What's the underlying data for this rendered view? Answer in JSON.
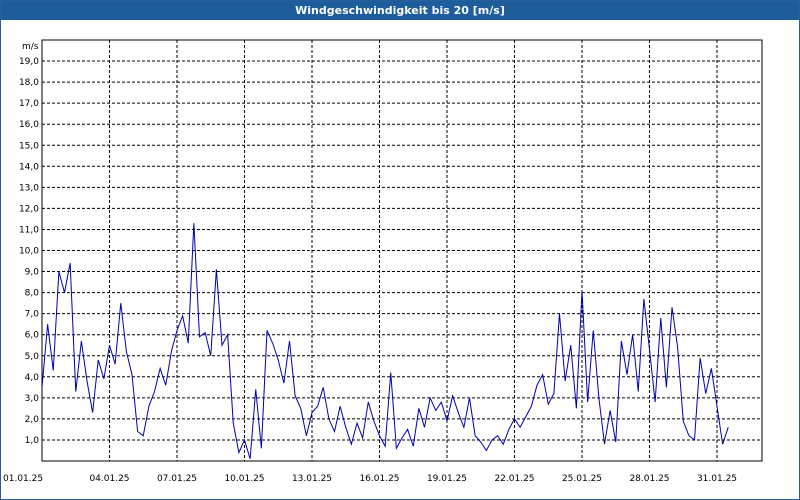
{
  "window": {
    "title": "Windgeschwindigkeit bis 20 [m/s]"
  },
  "chart_data": {
    "type": "line",
    "title": "Windgeschwindigkeit bis 20 [m/s]",
    "unit_label": "m/s",
    "ylim": [
      0,
      20
    ],
    "yticks": [
      "1,0",
      "2,0",
      "3,0",
      "4,0",
      "5,0",
      "6,0",
      "7,0",
      "8,0",
      "9,0",
      "10,0",
      "11,0",
      "12,0",
      "13,0",
      "14,0",
      "15,0",
      "16,0",
      "17,0",
      "18,0",
      "19,0"
    ],
    "xlim": [
      "01.01.25",
      "01.02.25"
    ],
    "xticks": [
      "01.01.25",
      "04.01.25",
      "07.01.25",
      "10.01.25",
      "13.01.25",
      "16.01.25",
      "19.01.25",
      "22.01.25",
      "25.01.25",
      "28.01.25",
      "31.01.25"
    ],
    "grid": true,
    "line_color": "#0000b0",
    "series": [
      {
        "x_days": [
          0,
          0.25,
          0.5,
          0.75,
          1.0,
          1.25,
          1.5,
          1.75,
          2.0,
          2.25,
          2.5,
          2.75,
          3.0,
          3.25,
          3.5,
          3.75,
          4.0,
          4.25,
          4.5,
          4.75,
          5.0,
          5.25,
          5.5,
          5.75,
          6.0,
          6.25,
          6.5,
          6.75,
          7.0,
          7.25,
          7.5,
          7.75,
          8.0,
          8.25,
          8.5,
          8.75,
          9.0,
          9.25,
          9.5,
          9.75,
          10.0,
          10.25,
          10.5,
          10.75,
          11.0,
          11.25,
          11.5,
          11.75,
          12.0,
          12.25,
          12.5,
          12.75,
          13.0,
          13.25,
          13.5,
          13.75,
          14.0,
          14.25,
          14.5,
          14.75,
          15.0,
          15.25,
          15.5,
          15.75,
          16.0,
          16.25,
          16.5,
          16.75,
          17.0,
          17.25,
          17.5,
          17.75,
          18.0,
          18.25,
          18.5,
          18.75,
          19.0,
          19.25,
          19.5,
          19.75,
          20.0,
          20.25,
          20.5,
          20.75,
          21.0,
          21.25,
          21.5,
          21.75,
          22.0,
          22.25,
          22.5,
          22.75,
          23.0,
          23.25,
          23.5,
          23.75,
          24.0,
          24.25,
          24.5,
          24.75,
          25.0,
          25.25,
          25.5,
          25.75,
          26.0,
          26.25,
          26.5,
          26.75,
          27.0,
          27.25,
          27.5,
          27.75,
          28.0,
          28.25,
          28.5,
          28.75,
          29.0,
          29.25,
          29.5,
          29.75,
          30.0,
          30.25,
          30.5,
          30.75,
          31.0,
          31.25,
          31.5,
          31.75,
          32.0
        ],
        "values": [
          3.5,
          6.5,
          4.3,
          9.0,
          8.0,
          9.4,
          3.3,
          5.7,
          3.8,
          2.3,
          4.8,
          3.9,
          5.5,
          4.6,
          7.5,
          5.2,
          4.1,
          1.4,
          1.2,
          2.6,
          3.3,
          4.4,
          3.6,
          5.2,
          6.2,
          6.9,
          5.6,
          11.3,
          5.9,
          6.1,
          5.0,
          9.1,
          5.5,
          6.0,
          1.8,
          0.4,
          1.0,
          0.1,
          3.4,
          0.6,
          6.2,
          5.6,
          4.8,
          3.7,
          5.7,
          3.1,
          2.5,
          1.2,
          2.3,
          2.6,
          3.5,
          2.0,
          1.4,
          2.6,
          1.6,
          0.8,
          1.8,
          1.1,
          2.8,
          1.9,
          1.2,
          0.7,
          4.2,
          0.6,
          1.1,
          1.5,
          0.7,
          2.5,
          1.6,
          3.0,
          2.4,
          2.8,
          1.9,
          3.1,
          2.3,
          1.6,
          3.0,
          1.2,
          0.9,
          0.5,
          1.0,
          1.2,
          0.8,
          1.5,
          2.0,
          1.6,
          2.1,
          2.6,
          3.6,
          4.1,
          2.7,
          3.2,
          7.0,
          3.8,
          5.5,
          2.5,
          8.1,
          2.8,
          6.2,
          3.0,
          0.8,
          2.4,
          0.9,
          5.7,
          4.1,
          6.0,
          3.3,
          7.7,
          5.3,
          2.8,
          6.8,
          3.5,
          7.3,
          5.4,
          1.9,
          1.2,
          1.0,
          4.9,
          3.2,
          4.4,
          2.6,
          0.8,
          1.6
        ]
      }
    ]
  }
}
